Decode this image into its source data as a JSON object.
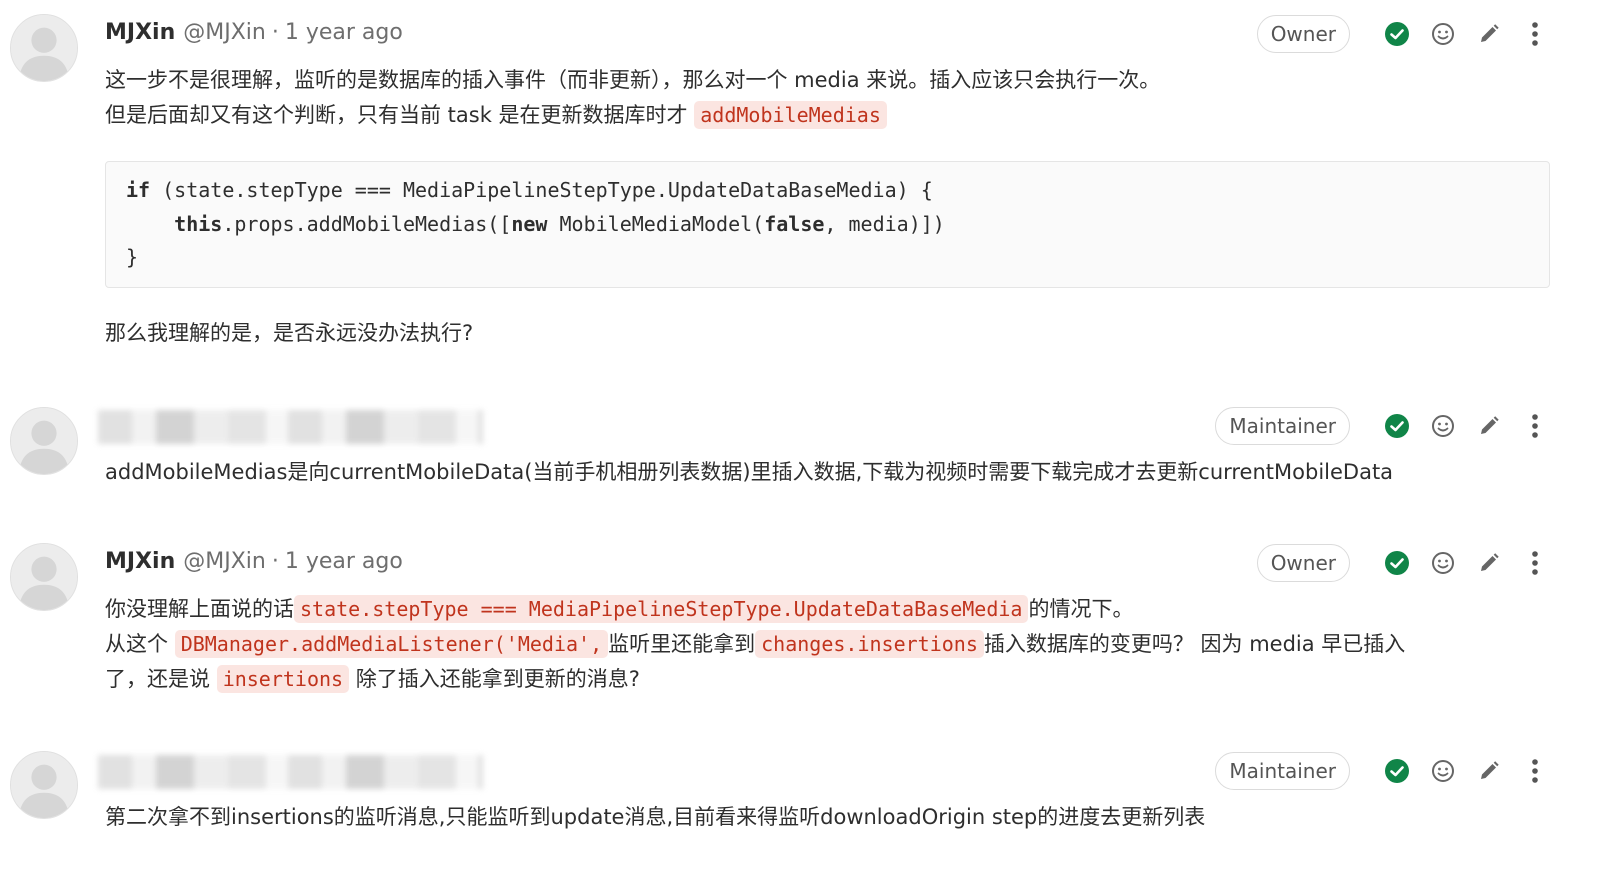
{
  "notes": [
    {
      "author_name": "MJXin",
      "author_handle": "@MJXin",
      "separator": "·",
      "time": "1 year ago",
      "role": "Owner",
      "lines": [
        "这一步不是很理解，监听的是数据库的插入事件（而非更新），那么对一个 media 来说。插入应该只会执行一次。",
        "但是后面却又有这个判断，只有当前 task 是在更新数据库时才"
      ],
      "inline_code_1": "addMobileMedias",
      "code": {
        "line1_kw": "if",
        "line1_rest": " (state.stepType === MediaPipelineStepType.UpdateDataBaseMedia) {",
        "line2_indent": "    ",
        "line2_kw1": "this",
        "line2_mid1": ".props.addMobileMedias([",
        "line2_kw2": "new",
        "line2_mid2": " MobileMediaModel(",
        "line2_kw3": "false",
        "line2_end": ", media)])",
        "line3": "}"
      },
      "after_code": "那么我理解的是，是否永远没办法执行?"
    },
    {
      "role": "Maintainer",
      "text": "addMobileMedias是向currentMobileData(当前手机相册列表数据)里插入数据,下载为视频时需要下载完成才去更新currentMobileData"
    },
    {
      "author_name": "MJXin",
      "author_handle": "@MJXin",
      "separator": "·",
      "time": "1 year ago",
      "role": "Owner",
      "l1_pre": "你没理解上面说的话",
      "l1_code": "state.stepType === MediaPipelineStepType.UpdateDataBaseMedia",
      "l1_post": "的情况下。",
      "l2_pre": "从这个 ",
      "l2_code1": "DBManager.addMediaListener('Media',",
      "l2_mid": "监听里还能拿到",
      "l2_code2": "changes.insertions",
      "l2_post": "插入数据库的变更吗？ 因为 media 早已插入",
      "l3_pre": "了，还是说 ",
      "l3_code": "insertions",
      "l3_post": " 除了插入还能拿到更新的消息?"
    },
    {
      "role": "Maintainer",
      "text": "第二次拿不到insertions的监听消息,只能监听到update消息,目前看来得监听downloadOrigin step的进度去更新列表"
    }
  ],
  "icons": [
    "avatar-icon",
    "resolved-check-icon",
    "emoji-icon",
    "edit-pencil-icon",
    "more-actions-icon"
  ],
  "colors": {
    "check_green": "#108548",
    "inline_code_text": "#c0341d",
    "inline_code_bg": "#fbe5e1",
    "badge_border": "#dbdbdb"
  }
}
